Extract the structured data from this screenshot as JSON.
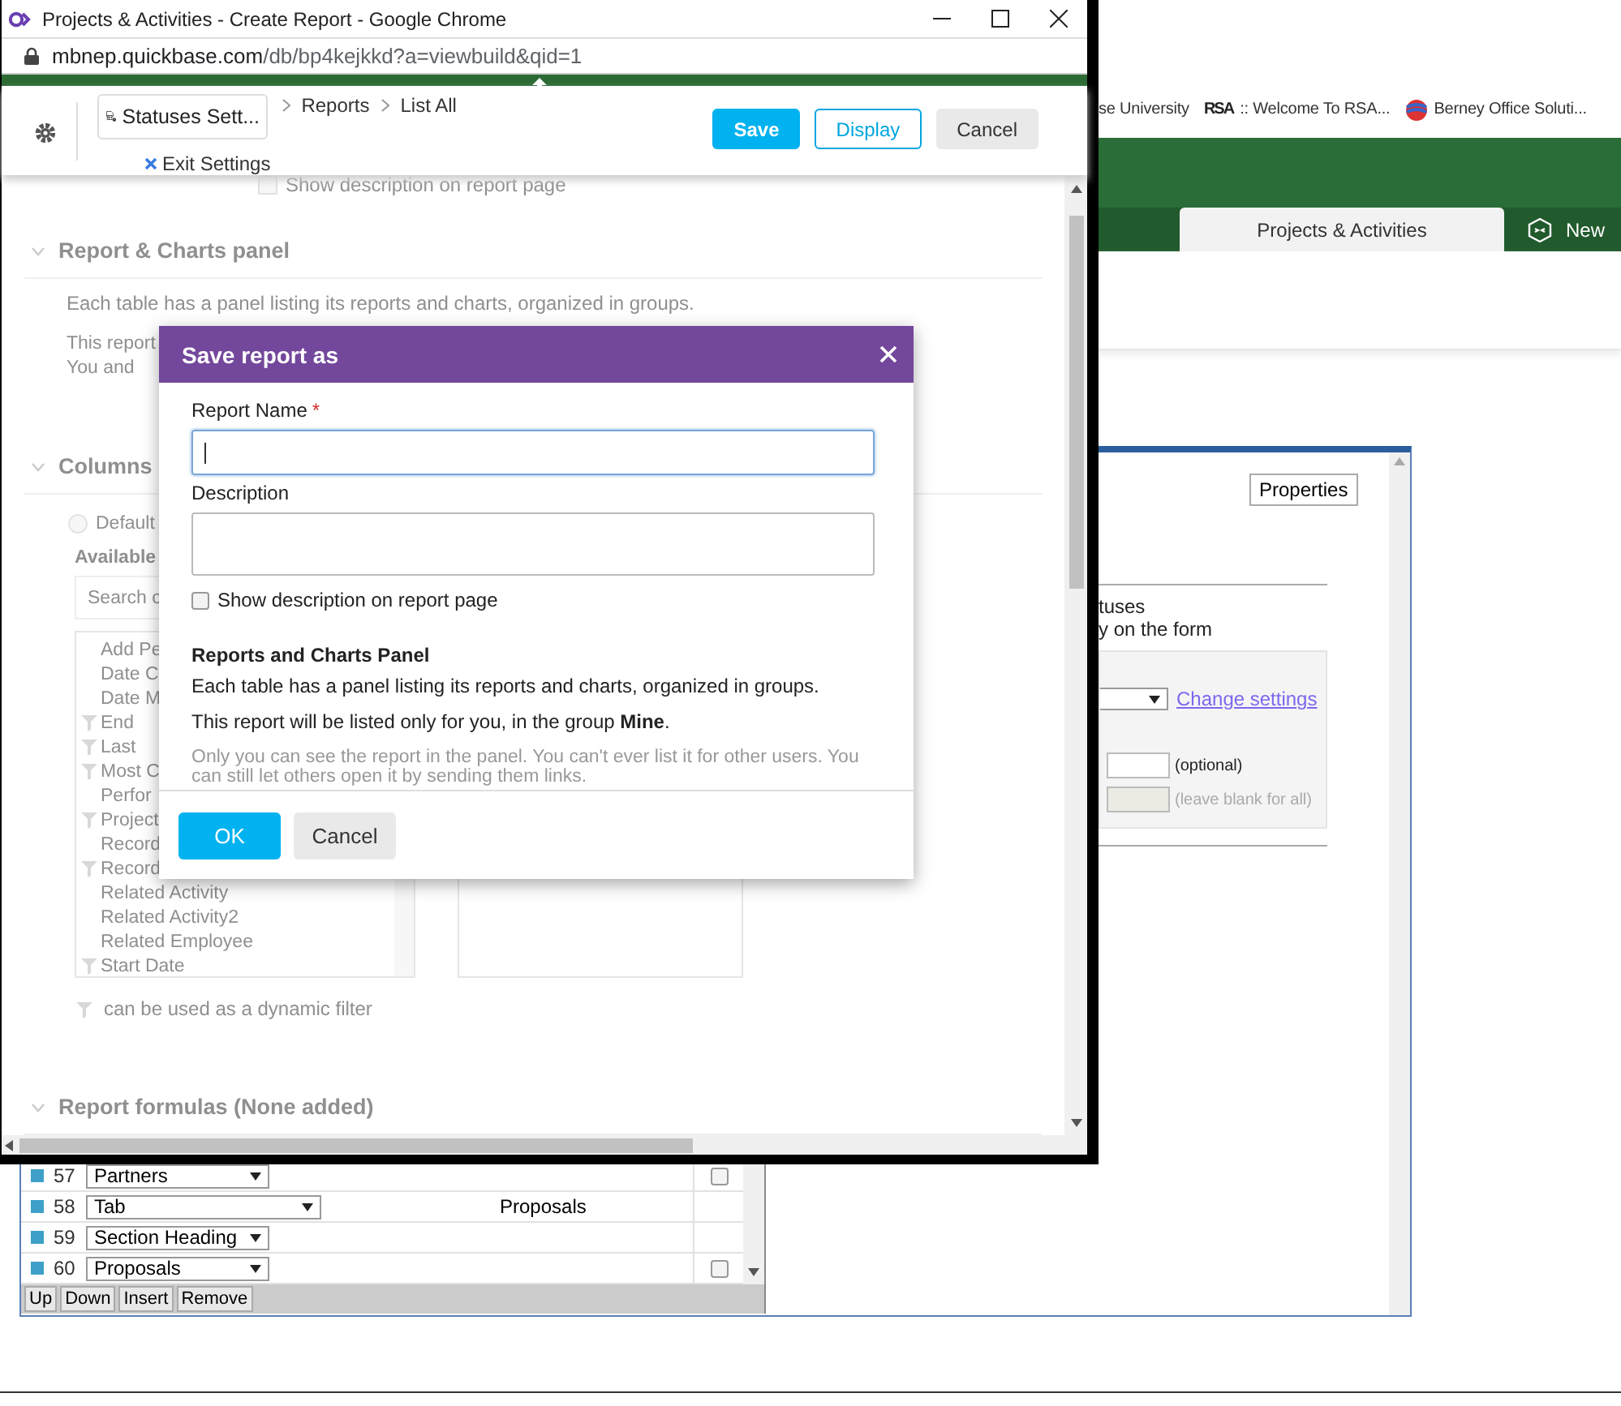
{
  "browser_window": {
    "bookmarks": [
      {
        "label": "se University",
        "kind": "none"
      },
      {
        "label": ":: Welcome To RSA...",
        "kind": "rsa",
        "logo": "RSA"
      },
      {
        "label": "Berney Office Soluti...",
        "kind": "globe"
      }
    ],
    "app_tabs": [
      {
        "label": "Projects & Activities",
        "selected": true,
        "kind": "plain"
      },
      {
        "label": "New",
        "selected": false,
        "kind": "cube"
      }
    ],
    "properties_button": "Properties",
    "text_lines": [
      "tuses",
      "y on the form"
    ],
    "change_settings_link": "Change settings",
    "optional_hint": "(optional)",
    "blank_hint": "(leave blank for all)",
    "field_rows": [
      {
        "number": "57",
        "field": "Partners",
        "kind": "field",
        "checked": false
      },
      {
        "number": "58",
        "field": "Tab",
        "kind": "tab",
        "column_3": "Proposals"
      },
      {
        "number": "59",
        "field": "Section Heading",
        "kind": "heading"
      },
      {
        "number": "60",
        "field": "Proposals",
        "kind": "field",
        "checked": false
      }
    ],
    "row_buttons": [
      "Up",
      "Down",
      "Insert",
      "Remove"
    ]
  },
  "popup_window": {
    "title": "Projects & Activities - Create Report - Google Chrome",
    "url_host": "mbnep.quickbase.com",
    "url_path": "/db/bp4kejkkd?a=viewbuild&qid=1",
    "table_button": "Statuses Sett...",
    "breadcrumbs": [
      "Reports",
      "List All"
    ],
    "exit_settings": "Exit Settings",
    "actions": [
      {
        "label": "Save",
        "kind": "primary"
      },
      {
        "label": "Display",
        "kind": "outline"
      },
      {
        "label": "Cancel",
        "kind": "plain"
      }
    ],
    "page": {
      "show_description": {
        "label": "Show description on report page",
        "checked": false
      },
      "report_panel": {
        "heading": "Report & Charts panel",
        "text": "Each table has a panel listing its reports and charts, organized in groups.",
        "cut_lines": [
          "This report",
          "You and"
        ]
      },
      "columns": {
        "heading": "Columns",
        "default_option": {
          "label": "Default",
          "selected": false
        },
        "available_label": "Available",
        "search_placeholder": "Search c",
        "items": [
          {
            "label": "Add Pe",
            "filterable": false
          },
          {
            "label": "Date C",
            "filterable": false
          },
          {
            "label": "Date M",
            "filterable": false
          },
          {
            "label": "End",
            "filterable": true
          },
          {
            "label": "Last",
            "filterable": true
          },
          {
            "label": "Most C",
            "filterable": true
          },
          {
            "label": "Perfor",
            "filterable": false
          },
          {
            "label": "Project",
            "filterable": true
          },
          {
            "label": "Record",
            "filterable": false
          },
          {
            "label": "Record",
            "filterable": true
          },
          {
            "label": "Related Activity",
            "filterable": false
          },
          {
            "label": "Related Activity2",
            "filterable": false
          },
          {
            "label": "Related Employee",
            "filterable": false
          },
          {
            "label": "Start Date",
            "filterable": true
          }
        ]
      },
      "filter_note": "can be used as a dynamic filter",
      "formulas_heading": "Report formulas (None added)"
    },
    "dialog": {
      "title": "Save report as",
      "name_label": "Report Name",
      "required_mark": "*",
      "name_focused": true,
      "description_label": "Description",
      "show_description": {
        "label": "Show description on report page",
        "checked": false
      },
      "panel_heading": "Reports and Charts Panel",
      "panel_text": "Each table has a panel listing its reports and charts, organized in groups.",
      "listing_text": "This report will be listed only for you, in the group **Mine**.",
      "note": "Only you can see the report in the panel. You can't ever list it for other users. You can still let others open it by sending them links.",
      "buttons": [
        {
          "label": "OK",
          "kind": "primary"
        },
        {
          "label": "Cancel",
          "kind": "plain"
        }
      ]
    }
  }
}
